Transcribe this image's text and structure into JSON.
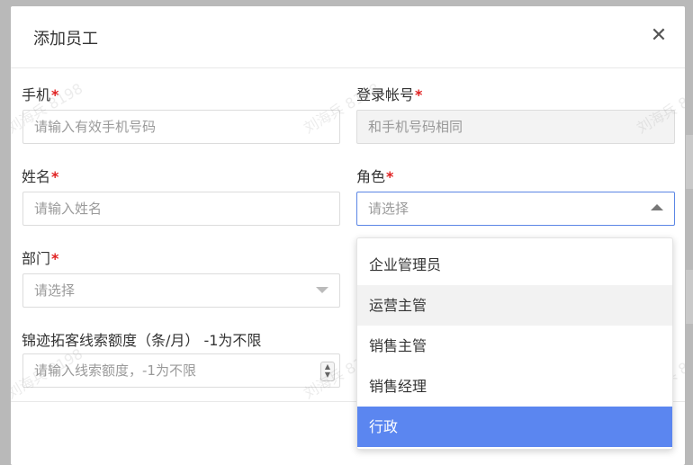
{
  "dialog": {
    "title": "添加员工",
    "close_icon": "close-icon"
  },
  "form": {
    "phone": {
      "label": "手机",
      "required_mark": "*",
      "placeholder": "请输入有效手机号码"
    },
    "login_account": {
      "label": "登录帐号",
      "required_mark": "*",
      "value": "和手机号码相同"
    },
    "name": {
      "label": "姓名",
      "required_mark": "*",
      "placeholder": "请输入姓名"
    },
    "role": {
      "label": "角色",
      "required_mark": "*",
      "placeholder": "请选择"
    },
    "department": {
      "label": "部门",
      "required_mark": "*",
      "placeholder": "请选择"
    },
    "lead_quota": {
      "label": "锦迹拓客线索额度（条/月） -1为不限",
      "placeholder": "请输入线索额度，-1为不限"
    }
  },
  "role_dropdown": {
    "options": [
      "企业管理员",
      "运营主管",
      "销售主管",
      "销售经理",
      "行政"
    ],
    "hovered": "运营主管",
    "selected": "行政"
  },
  "watermark": {
    "text": "刘海兵 8198"
  },
  "colors": {
    "accent": "#5b86f0",
    "required": "#e02020"
  }
}
